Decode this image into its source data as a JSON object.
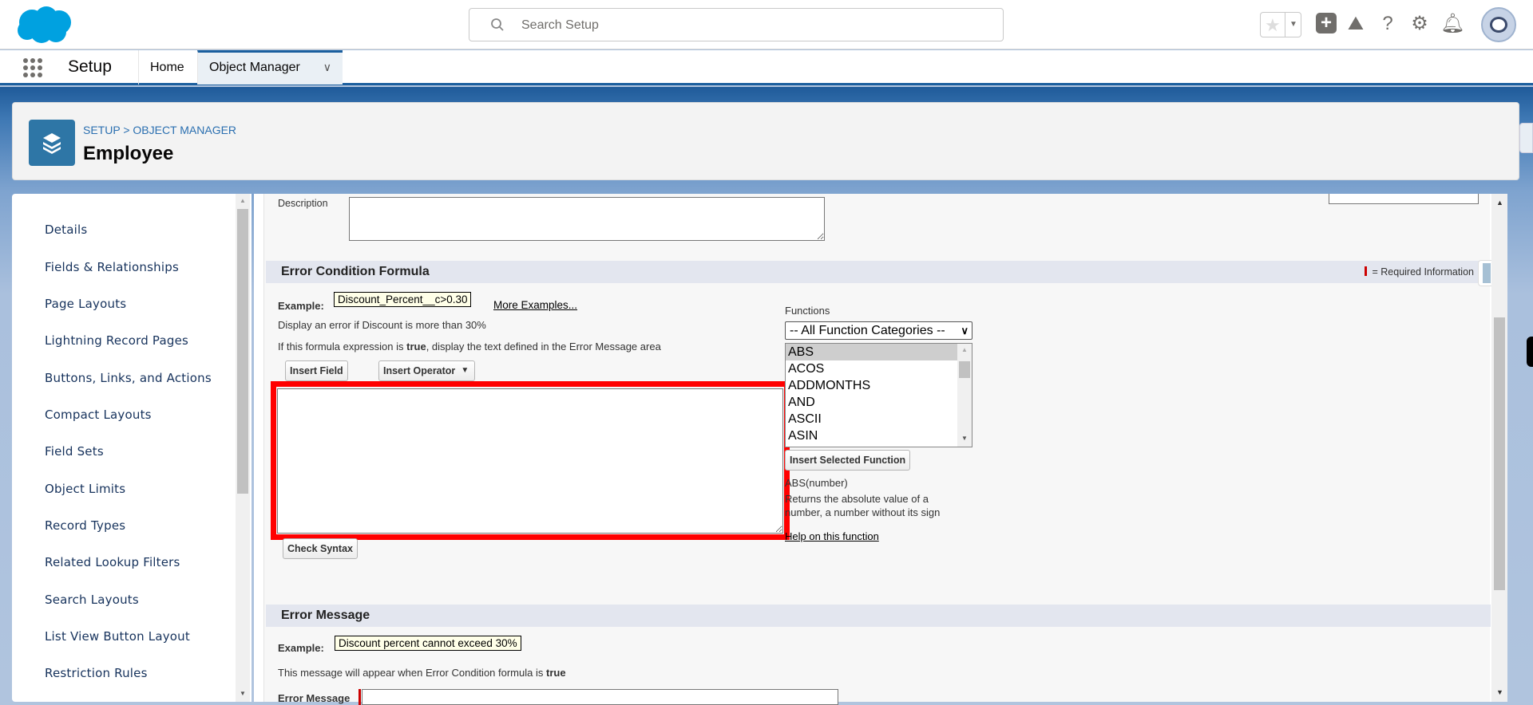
{
  "header": {
    "search_placeholder": "Search Setup",
    "brand_color": "#00a1e0"
  },
  "nav": {
    "app_name": "Setup",
    "tabs": [
      {
        "label": "Home"
      },
      {
        "label": "Object Manager"
      }
    ]
  },
  "page_header": {
    "breadcrumb": "SETUP > OBJECT MANAGER",
    "title": "Employee"
  },
  "sidebar": {
    "items": [
      {
        "label": "Details"
      },
      {
        "label": "Fields & Relationships"
      },
      {
        "label": "Page Layouts"
      },
      {
        "label": "Lightning Record Pages"
      },
      {
        "label": "Buttons, Links, and Actions"
      },
      {
        "label": "Compact Layouts"
      },
      {
        "label": "Field Sets"
      },
      {
        "label": "Object Limits"
      },
      {
        "label": "Record Types"
      },
      {
        "label": "Related Lookup Filters"
      },
      {
        "label": "Search Layouts"
      },
      {
        "label": "List View Button Layout"
      },
      {
        "label": "Restriction Rules"
      }
    ]
  },
  "form": {
    "description_label": "Description",
    "description_value": "",
    "ecf": {
      "title": "Error Condition Formula",
      "required_info": "= Required Information",
      "example_label": "Example:",
      "example_value": "Discount_Percent__c>0.30",
      "more_examples": "More Examples...",
      "example_desc": "Display an error if Discount is more than 30%",
      "hint_pre": "If this formula expression is ",
      "hint_bold": "true",
      "hint_post": ", display the text defined in the Error Message area",
      "insert_field": "Insert Field",
      "insert_operator": "Insert Operator",
      "formula_value": "",
      "check_syntax": "Check Syntax",
      "functions_label": "Functions",
      "category_selected": "-- All Function Categories --",
      "functions": [
        "ABS",
        "ACOS",
        "ADDMONTHS",
        "AND",
        "ASCII",
        "ASIN"
      ],
      "selected_function": "ABS",
      "insert_selected": "Insert Selected Function",
      "signature": "ABS(number)",
      "fn_desc": "Returns the absolute value of a number, a number without its sign",
      "help_link": "Help on this function",
      "highlight_color": "#ff0000"
    },
    "em": {
      "title": "Error Message",
      "example_label": "Example:",
      "example_value": "Discount percent cannot exceed 30%",
      "hint_pre": "This message will appear when Error Condition formula is ",
      "hint_bold": "true",
      "field_label": "Error Message"
    }
  }
}
